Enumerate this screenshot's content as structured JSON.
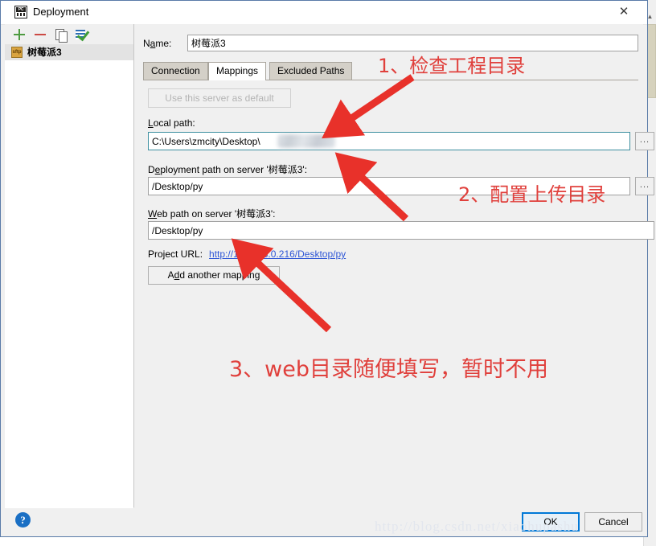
{
  "window": {
    "title": "Deployment",
    "app_icon": "pycharm-icon",
    "close_icon": "close-icon"
  },
  "sidebar": {
    "toolbar": [
      {
        "name": "add-server-button",
        "icon": "plus-icon",
        "color": "#4d9b40"
      },
      {
        "name": "remove-server-button",
        "icon": "minus-icon",
        "color": "#cc4a44"
      },
      {
        "name": "copy-server-button",
        "icon": "copy-icon",
        "color": "#6a6a6a"
      },
      {
        "name": "set-default-button",
        "icon": "green-check-icon",
        "color": "#3f9d37"
      }
    ],
    "items": [
      {
        "label": "树莓派3",
        "icon_label": "sftp",
        "selected": true
      }
    ]
  },
  "form": {
    "name_label": "Name:",
    "name_label_mnemonic": "a",
    "name_value": "树莓派3"
  },
  "tabs": [
    {
      "label": "Connection",
      "selected": false
    },
    {
      "label": "Mappings",
      "selected": true
    },
    {
      "label": "Excluded Paths",
      "selected": false
    }
  ],
  "mappings": {
    "use_default_button": "Use this server as default",
    "use_default_enabled": false,
    "local_path_label": "Local path:",
    "local_path_mnemonic": "L",
    "local_path_value": "C:\\Users\\zmcity\\Desktop\\",
    "local_path_redacted": true,
    "deployment_path_label": "Deployment path on server '树莓派3':",
    "deployment_path_mnemonic": "e",
    "deployment_path_value": "/Desktop/py",
    "web_path_label": "Web path on server '树莓派3':",
    "web_path_mnemonic": "W",
    "web_path_value": "/Desktop/py",
    "project_url_label": "Project URL:",
    "project_url_value": "http://192.168.0.216/Desktop/py",
    "project_url_color": "#2f57d6",
    "add_mapping_button": "Add another mapping",
    "add_mapping_mnemonic": "d",
    "browse_button_label": "..."
  },
  "footer": {
    "help_label": "?",
    "ok_label": "OK",
    "cancel_label": "Cancel"
  },
  "annotations": {
    "color": "#e0403c",
    "items": [
      {
        "text": "1、检查工程目录"
      },
      {
        "text": "2、配置上传目录"
      },
      {
        "text": "3、web目录随便填写，暂时不用"
      }
    ]
  },
  "watermark": {
    "text": "http://blog.csdn.net/xiaohupashu"
  }
}
